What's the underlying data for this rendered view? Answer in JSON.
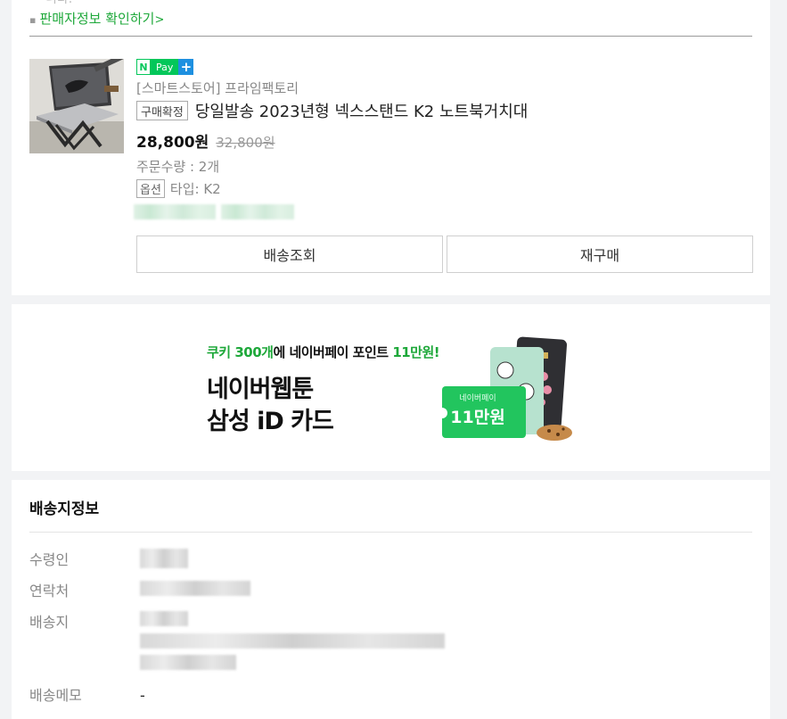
{
  "order": {
    "top_cut_text": "니다.",
    "seller_link": "판매자정보 확인하기",
    "seller_link_arrow": ">",
    "npay": {
      "n": "N",
      "pay": "Pay",
      "plus": "+"
    },
    "store": "[스마트스토어] 프라임팩토리",
    "status_tag": "구매확정",
    "product_title": "당일발송 2023년형 넥스스탠드 K2 노트북거치대",
    "price": "28,800원",
    "original_price": "32,800원",
    "quantity": "주문수량 : 2개",
    "option_tag": "옵션",
    "option_value": "타입: K2",
    "buttons": {
      "track": "배송조회",
      "rebuy": "재구매"
    }
  },
  "banner": {
    "head_green_1": "쿠키 300개",
    "head_black": "에 네이버페이 포인트 ",
    "head_green_2": "11만원!",
    "line1": "네이버웹툰",
    "line2": "삼성 iD 카드",
    "coupon_label": "네이버페이",
    "coupon_value": "11만원"
  },
  "shipping": {
    "title": "배송지정보",
    "receiver_label": "수령인",
    "contact_label": "연락처",
    "address_label": "배송지",
    "memo_label": "배송메모",
    "memo_value": "-"
  },
  "colors": {
    "npay_green": "#03c75a",
    "link_green": "#1ea83a",
    "plus_blue": "#1e90e0"
  }
}
